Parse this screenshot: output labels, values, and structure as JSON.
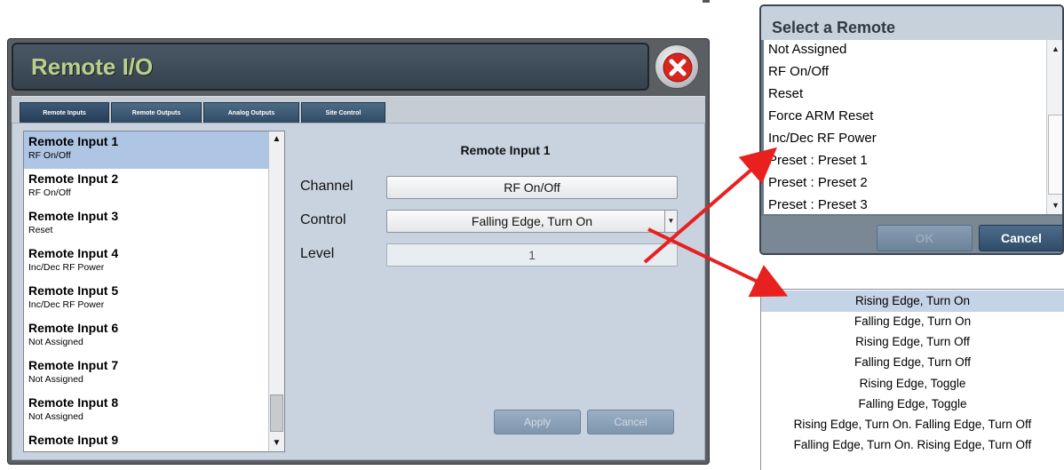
{
  "window": {
    "title": "Remote I/O"
  },
  "tabs": [
    {
      "label": "Remote Inputs",
      "active": true
    },
    {
      "label": "Remote Outputs",
      "active": false
    },
    {
      "label": "Analog Outputs",
      "active": false
    },
    {
      "label": "Site Control",
      "active": false
    }
  ],
  "inputs": [
    {
      "name": "Remote Input 1",
      "assignment": "RF On/Off",
      "selected": true
    },
    {
      "name": "Remote Input 2",
      "assignment": "RF On/Off"
    },
    {
      "name": "Remote Input 3",
      "assignment": "Reset"
    },
    {
      "name": "Remote Input 4",
      "assignment": "Inc/Dec RF Power"
    },
    {
      "name": "Remote Input 5",
      "assignment": "Inc/Dec RF Power"
    },
    {
      "name": "Remote Input 6",
      "assignment": "Not Assigned"
    },
    {
      "name": "Remote Input 7",
      "assignment": "Not Assigned"
    },
    {
      "name": "Remote Input 8",
      "assignment": "Not Assigned"
    },
    {
      "name": "Remote Input 9",
      "assignment": ""
    }
  ],
  "detail": {
    "title": "Remote Input 1",
    "channel_label": "Channel",
    "channel_value": "RF On/Off",
    "control_label": "Control",
    "control_value": "Falling Edge, Turn On",
    "level_label": "Level",
    "level_value": "1",
    "apply_label": "Apply",
    "cancel_label": "Cancel"
  },
  "select_remote": {
    "title": "Select a Remote",
    "options": [
      "Not Assigned",
      "RF On/Off",
      "Reset",
      "Force ARM Reset",
      "Inc/Dec RF Power",
      "Preset : Preset 1",
      "Preset : Preset 2",
      "Preset : Preset 3"
    ],
    "ok_label": "OK",
    "cancel_label": "Cancel"
  },
  "control_options": {
    "options": [
      "Rising Edge, Turn On",
      "Falling Edge, Turn On",
      "Rising Edge, Turn Off",
      "Falling Edge, Turn Off",
      "Rising Edge, Toggle",
      "Falling Edge, Toggle",
      "Rising Edge, Turn On. Falling Edge, Turn Off",
      "Falling Edge, Turn On. Rising Edge, Turn Off"
    ],
    "selected_index": 0
  },
  "colors": {
    "title_green": "#b9d08a",
    "arrow_red": "#e8211f",
    "selection_blue": "#aec6e4"
  },
  "icons": {
    "close": "close-icon",
    "scroll_up": "arrow-up-icon",
    "scroll_down": "arrow-down-icon",
    "dropdown": "chevron-down-icon"
  }
}
